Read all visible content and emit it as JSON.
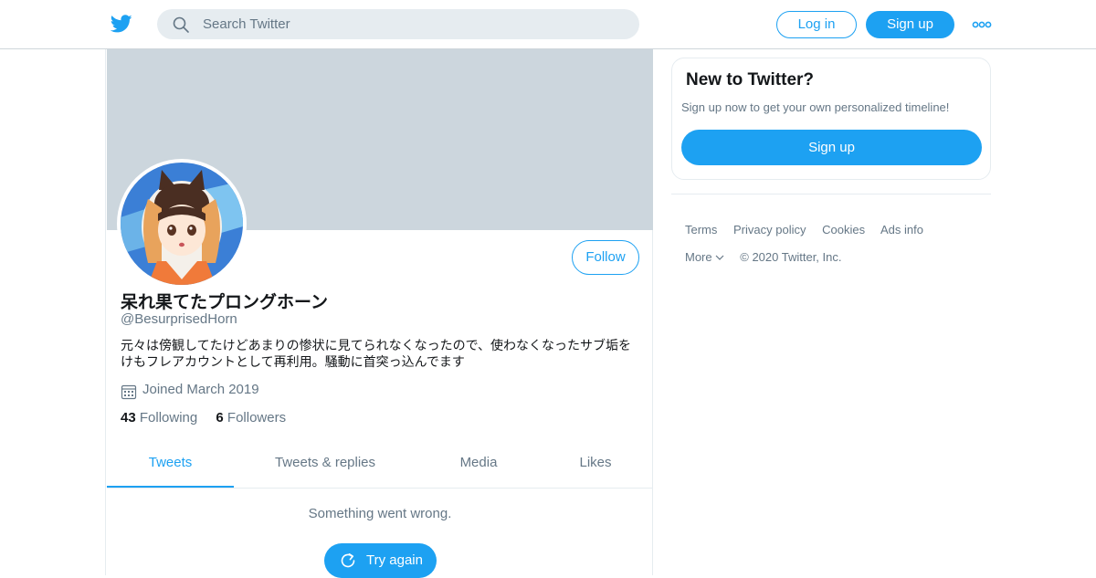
{
  "colors": {
    "accent": "#1da1f2",
    "text": "#14171a",
    "secondary": "#657786",
    "banner": "#ccd6dd"
  },
  "topbar": {
    "logo_icon": "twitter-bird-icon",
    "search_placeholder": "Search Twitter",
    "login_label": "Log in",
    "signup_label": "Sign up",
    "more_icon": "more-dots-icon"
  },
  "profile": {
    "display_name": "呆れ果てたプロングホーン",
    "handle": "@BesurprisedHorn",
    "bio": "元々は傍観してたけどあまりの惨状に見てられなくなったので、使わなくなったサブ垢をけもフレアカウントとして再利用。騒動に首突っ込んでます",
    "joined": "Joined March 2019",
    "following_count": "43",
    "following_label": "Following",
    "followers_count": "6",
    "followers_label": "Followers",
    "follow_label": "Follow"
  },
  "tabs": [
    {
      "label": "Tweets",
      "active": true
    },
    {
      "label": "Tweets & replies",
      "active": false
    },
    {
      "label": "Media",
      "active": false
    },
    {
      "label": "Likes",
      "active": false
    }
  ],
  "timeline": {
    "error_text": "Something went wrong.",
    "retry_label": "Try again"
  },
  "sidebar": {
    "title": "New to Twitter?",
    "subtitle": "Sign up now to get your own personalized timeline!",
    "signup_label": "Sign up"
  },
  "footer": {
    "links": [
      "Terms",
      "Privacy policy",
      "Cookies",
      "Ads info"
    ],
    "more_label": "More",
    "copyright": "© 2020 Twitter, Inc."
  }
}
